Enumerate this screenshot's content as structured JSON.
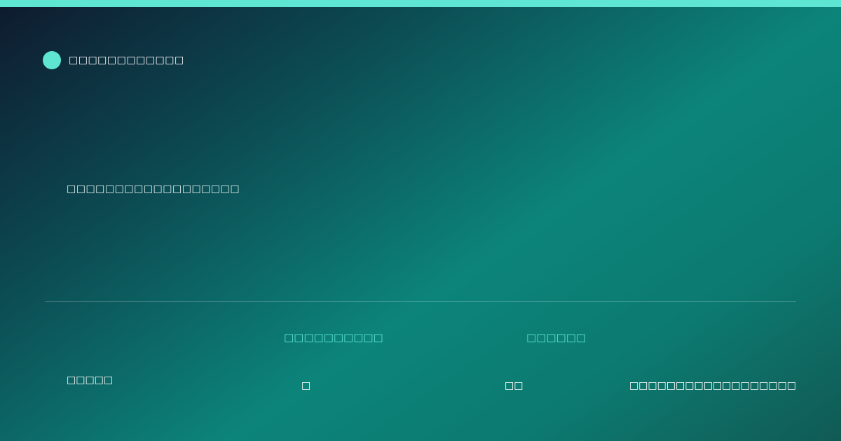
{
  "brand": {
    "name": "□□□□□□□□□□□□"
  },
  "hero": {
    "tagline": "□□□□□□□□□□□□□□□□□□"
  },
  "footer": {
    "left_label": "□□□□□",
    "columns": [
      {
        "heading": "□□□□□□□□□□",
        "value": "□"
      },
      {
        "heading": "□□□□□□",
        "value": "□□"
      }
    ],
    "right_value": "□□□□□□□□□□□□□□□□□□"
  },
  "colors": {
    "accent": "#5ee6d2",
    "bg_dark": "#0e1a2e",
    "bg_teal": "#0c847a"
  }
}
